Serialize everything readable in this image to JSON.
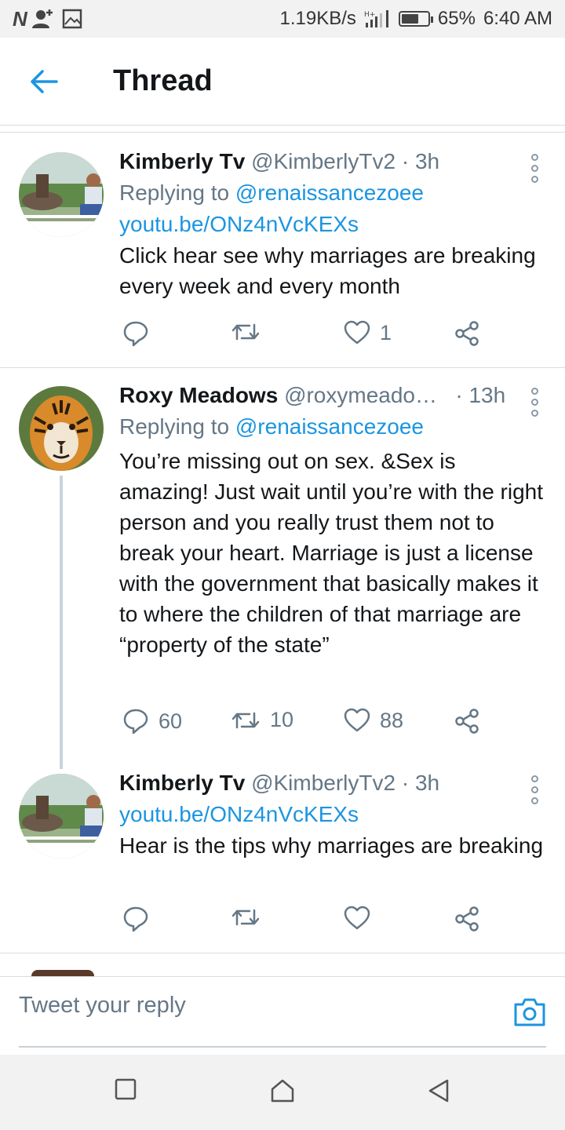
{
  "status_bar": {
    "left_logo": "N",
    "speed": "1.19KB/s",
    "battery_percent": "65%",
    "battery_level": 0.65,
    "time": "6:40 AM"
  },
  "header": {
    "title": "Thread"
  },
  "tweets": [
    {
      "name": "Kimberly Tv",
      "handle": "@KimberlyTv2",
      "dot": "·",
      "time": "3h",
      "replying_prefix": "Replying to",
      "replying_to": "@renaissancezoee",
      "link": "youtu.be/ONz4nVcKEXs",
      "text": "Click hear see why marriages are breaking every week and every month",
      "replies": "",
      "retweets": "",
      "likes": "1"
    },
    {
      "name": "Roxy Meadows",
      "handle": "@roxymeado…",
      "dot": "·",
      "time": "13h",
      "replying_prefix": "Replying to",
      "replying_to": "@renaissancezoee",
      "text": "You’re missing out on sex. &Sex is amazing! Just wait until you’re with the right person and you really trust them not to break your heart. Marriage is just a license with the government that basically makes it to where the children of that marriage are “property of the state”",
      "replies": "60",
      "retweets": "10",
      "likes": "88"
    },
    {
      "name": "Kimberly Tv",
      "handle": "@KimberlyTv2",
      "dot": "·",
      "time": "3h",
      "link": "youtu.be/ONz4nVcKEXs",
      "text": "Hear is the tips why marriages are breaking",
      "replies": "",
      "retweets": "",
      "likes": ""
    }
  ],
  "reply_bar": {
    "placeholder": "Tweet your reply"
  },
  "colors": {
    "accent": "#1b95e0",
    "secondary_text": "#657786",
    "divider": "#d8dde2"
  }
}
